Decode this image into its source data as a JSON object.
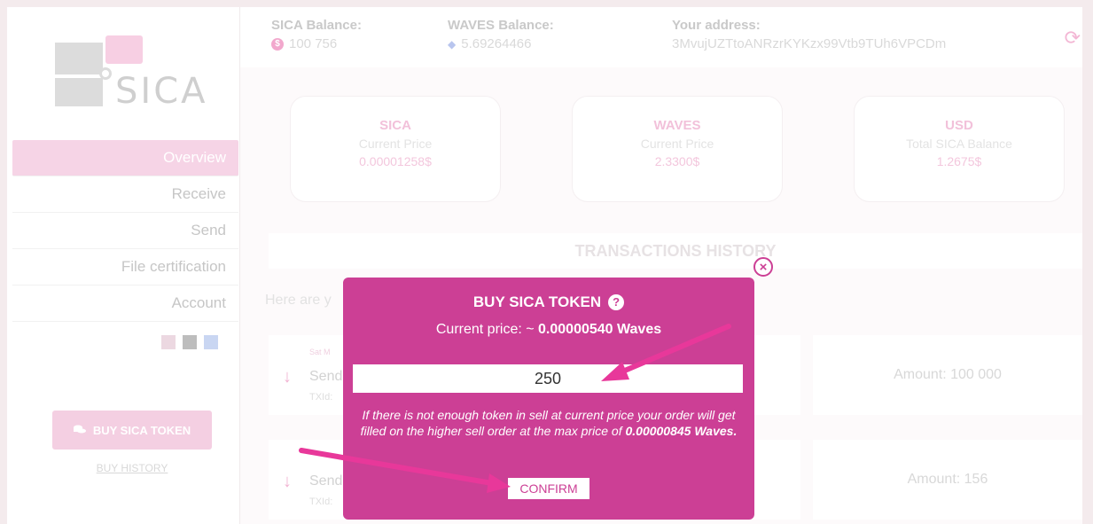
{
  "sidebar": {
    "logo_text": "SICA",
    "nav": [
      {
        "label": "Overview",
        "active": true
      },
      {
        "label": "Receive",
        "active": false
      },
      {
        "label": "Send",
        "active": false
      },
      {
        "label": "File certification",
        "active": false
      },
      {
        "label": "Account",
        "active": false
      }
    ],
    "theme_swatches": [
      "#ecd8e1",
      "#bdbdbd",
      "#c9d6f2"
    ],
    "buy_button_label": "BUY SICA TOKEN",
    "buy_history_label": "BUY HISTORY"
  },
  "header": {
    "sica_balance_label": "SICA Balance:",
    "sica_balance_value": "100 756",
    "waves_balance_label": "WAVES Balance:",
    "waves_balance_value": "5.69264466",
    "address_label": "Your address:",
    "address_value": "3MvujUZTtoANRzrKYKzx99Vtb9TUh6VPCDm"
  },
  "cards": [
    {
      "title": "SICA",
      "subtitle": "Current Price",
      "value": "0.00001258$"
    },
    {
      "title": "WAVES",
      "subtitle": "Current Price",
      "value": "2.3300$"
    },
    {
      "title": "USD",
      "subtitle": "Total SICA Balance",
      "value": "1.2675$"
    }
  ],
  "history": {
    "title": "TRANSACTIONS HISTORY",
    "intro": "Here are y",
    "rows": [
      {
        "date": "Sat M",
        "type": "Send",
        "txid": "TXId:",
        "amount": "Amount: 100 000"
      },
      {
        "date": "",
        "type": "Send",
        "txid": "TXId:",
        "amount": "Amount: 156"
      }
    ]
  },
  "modal": {
    "title": "BUY SICA TOKEN",
    "price_prefix": "Current price: ~ ",
    "price_value": "0.00000540 Waves",
    "amount_value": "250",
    "note_text": "If there is not enough token in sell at current price your order will get filled on the higher sell order at the max price of",
    "note_max_price": "0.00000845 Waves.",
    "confirm_label": "CONFIRM"
  },
  "colors": {
    "accent": "#cc3f95",
    "annotation_arrow": "#e8389a"
  }
}
